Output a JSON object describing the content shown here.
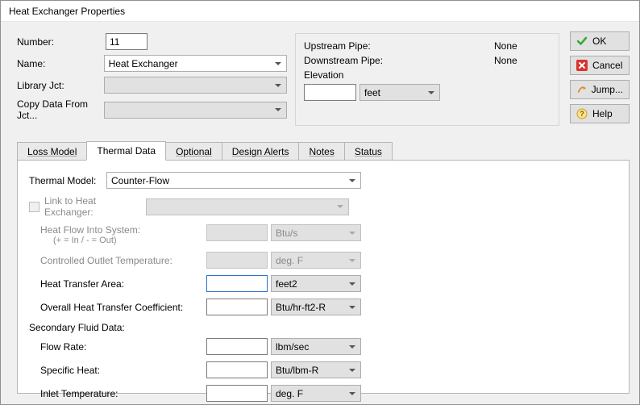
{
  "title": "Heat Exchanger Properties",
  "colors": {
    "accent": "#2a6fc9"
  },
  "form": {
    "number_label": "Number:",
    "number_value": "11",
    "name_label": "Name:",
    "name_value": "Heat Exchanger",
    "library_label": "Library Jct:",
    "library_value": "",
    "copy_label": "Copy Data From Jct...",
    "copy_value": ""
  },
  "pipes": {
    "upstream_label": "Upstream Pipe:",
    "upstream_value": "None",
    "downstream_label": "Downstream Pipe:",
    "downstream_value": "None",
    "elevation_label": "Elevation",
    "elevation_value": "",
    "elevation_unit": "feet"
  },
  "buttons": {
    "ok": "OK",
    "cancel": "Cancel",
    "jump": "Jump...",
    "help": "Help"
  },
  "tabs": {
    "loss": "Loss Model",
    "thermal": "Thermal Data",
    "optional": "Optional",
    "design": "Design Alerts",
    "notes": "Notes",
    "status": "Status"
  },
  "thermal": {
    "model_label": "Thermal Model:",
    "model_value": "Counter-Flow",
    "link_label": "Link to Heat Exchanger:",
    "link_target": "",
    "heat_flow_label": "Heat Flow Into System:",
    "heat_flow_hint": "(+ = In / - = Out)",
    "heat_flow_value": "",
    "heat_flow_unit": "Btu/s",
    "cot_label": "Controlled Outlet Temperature:",
    "cot_value": "",
    "cot_unit": "deg. F",
    "area_label": "Heat Transfer Area:",
    "area_value": "",
    "area_unit": "feet2",
    "coef_label": "Overall Heat Transfer Coefficient:",
    "coef_value": "",
    "coef_unit": "Btu/hr-ft2-R",
    "secondary_header": "Secondary Fluid Data:",
    "flow_label": "Flow Rate:",
    "flow_value": "",
    "flow_unit": "lbm/sec",
    "spec_label": "Specific Heat:",
    "spec_value": "",
    "spec_unit": "Btu/lbm-R",
    "inlet_label": "Inlet Temperature:",
    "inlet_value": "",
    "inlet_unit": "deg. F"
  }
}
